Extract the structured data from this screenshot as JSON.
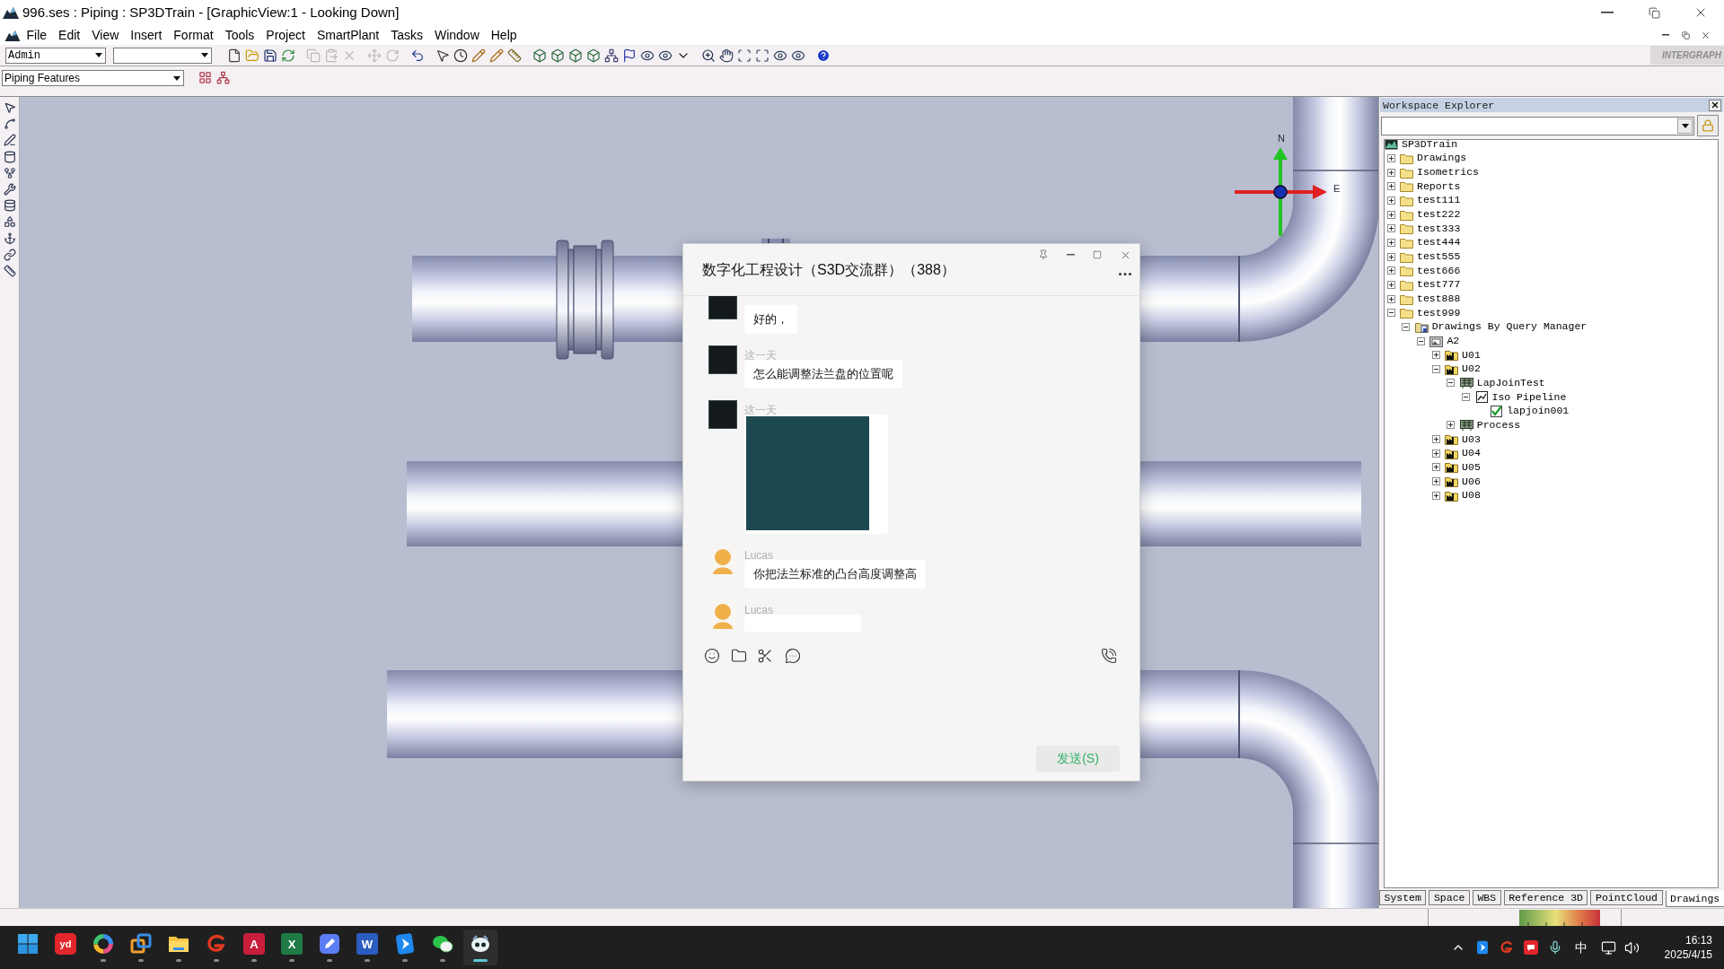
{
  "window": {
    "title": "996.ses : Piping : SP3DTrain - [GraphicView:1 - Looking Down]"
  },
  "menu": [
    "File",
    "Edit",
    "View",
    "Insert",
    "Format",
    "Tools",
    "Project",
    "SmartPlant",
    "Tasks",
    "Window",
    "Help"
  ],
  "toolbar": {
    "user_combo": "Admin",
    "groups": [
      [
        {
          "kind": "new",
          "disabled": false
        },
        {
          "kind": "open",
          "disabled": false
        },
        {
          "kind": "save",
          "disabled": false
        },
        {
          "kind": "refresh",
          "disabled": false
        }
      ],
      [
        {
          "kind": "copy",
          "disabled": true
        },
        {
          "kind": "paste",
          "disabled": true
        },
        {
          "kind": "delete",
          "disabled": true
        }
      ],
      [
        {
          "kind": "move",
          "disabled": true
        },
        {
          "kind": "rotate",
          "disabled": true
        }
      ],
      [
        {
          "kind": "undo",
          "disabled": false
        }
      ],
      [
        {
          "kind": "select",
          "disabled": false
        },
        {
          "kind": "clock",
          "disabled": false
        },
        {
          "kind": "pencil",
          "disabled": false
        },
        {
          "kind": "pencil",
          "disabled": false
        },
        {
          "kind": "ruler",
          "disabled": false
        }
      ],
      [
        {
          "kind": "cube",
          "disabled": false
        },
        {
          "kind": "cube",
          "disabled": false
        },
        {
          "kind": "cube",
          "disabled": false
        },
        {
          "kind": "cube",
          "disabled": false
        },
        {
          "kind": "network",
          "disabled": false
        },
        {
          "kind": "flag",
          "disabled": false
        },
        {
          "kind": "view",
          "disabled": false
        },
        {
          "kind": "view",
          "disabled": false
        },
        {
          "kind": "dropdown",
          "disabled": false
        }
      ],
      [
        {
          "kind": "zoom",
          "disabled": false
        },
        {
          "kind": "pan",
          "disabled": false
        },
        {
          "kind": "zoom_area",
          "disabled": false
        },
        {
          "kind": "fit",
          "disabled": false
        },
        {
          "kind": "view",
          "disabled": false
        },
        {
          "kind": "view",
          "disabled": false
        }
      ],
      [
        {
          "kind": "help",
          "disabled": false
        }
      ]
    ],
    "logo": "INTERGRAPH"
  },
  "task_bar": {
    "task_combo": "Piping Features"
  },
  "view": {
    "compass": {
      "north": "N",
      "east": "E"
    }
  },
  "workspace_explorer": {
    "title": "Workspace Explorer",
    "tree": [
      {
        "label": "SP3DTrain",
        "kind": "project",
        "children": [
          {
            "label": "Drawings",
            "kind": "folder",
            "expanded": false
          },
          {
            "label": "Isometrics",
            "kind": "folder",
            "expanded": false
          },
          {
            "label": "Reports",
            "kind": "folder",
            "expanded": false
          },
          {
            "label": "test111",
            "kind": "folder",
            "expanded": false
          },
          {
            "label": "test222",
            "kind": "folder",
            "expanded": false
          },
          {
            "label": "test333",
            "kind": "folder",
            "expanded": false
          },
          {
            "label": "test444",
            "kind": "folder",
            "expanded": false
          },
          {
            "label": "test555",
            "kind": "folder",
            "expanded": false
          },
          {
            "label": "test666",
            "kind": "folder",
            "expanded": false
          },
          {
            "label": "test777",
            "kind": "folder",
            "expanded": false
          },
          {
            "label": "test888",
            "kind": "folder",
            "expanded": false
          },
          {
            "label": "test999",
            "kind": "folder",
            "expanded": true,
            "children": [
              {
                "label": "Drawings By Query Manager",
                "kind": "query",
                "expanded": true,
                "children": [
                  {
                    "label": "A2",
                    "kind": "area",
                    "expanded": true,
                    "children": [
                      {
                        "label": "U01",
                        "kind": "unit",
                        "expanded": false
                      },
                      {
                        "label": "U02",
                        "kind": "unit",
                        "expanded": true,
                        "children": [
                          {
                            "label": "LapJoinTest",
                            "kind": "system",
                            "expanded": true,
                            "children": [
                              {
                                "label": "Iso Pipeline",
                                "kind": "iso",
                                "expanded": true,
                                "children": [
                                  {
                                    "label": "lapjoin001",
                                    "kind": "drawing"
                                  }
                                ]
                              }
                            ]
                          },
                          {
                            "label": "Process",
                            "kind": "system",
                            "expanded": false
                          }
                        ]
                      },
                      {
                        "label": "U03",
                        "kind": "unit",
                        "expanded": false
                      },
                      {
                        "label": "U04",
                        "kind": "unit",
                        "expanded": false
                      },
                      {
                        "label": "U05",
                        "kind": "unit",
                        "expanded": false
                      },
                      {
                        "label": "U06",
                        "kind": "unit",
                        "expanded": false
                      },
                      {
                        "label": "U08",
                        "kind": "unit",
                        "expanded": false
                      }
                    ]
                  }
                ]
              }
            ]
          }
        ]
      }
    ],
    "tabs": [
      {
        "label": "System",
        "selected": false
      },
      {
        "label": "Space",
        "selected": false
      },
      {
        "label": "WBS",
        "selected": false
      },
      {
        "label": "Reference 3D",
        "selected": false
      },
      {
        "label": "PointCloud",
        "selected": false
      },
      {
        "label": "Drawings",
        "selected": true
      }
    ]
  },
  "chat": {
    "title": "数字化工程设计（S3D交流群）（388）",
    "messages": [
      {
        "kind": "text",
        "avatar": {
          "kind": "photo"
        },
        "text": "好的，"
      },
      {
        "kind": "text",
        "avatar": {
          "kind": "photo"
        },
        "sender": "这一天",
        "text": "怎么能调整法兰盘的位置呢"
      },
      {
        "kind": "image",
        "avatar": {
          "kind": "photo"
        },
        "sender": "这一天"
      },
      {
        "kind": "text",
        "avatar": {
          "kind": "cartoon"
        },
        "sender": "Lucas",
        "text": "你把法兰标准的凸台高度调整高"
      },
      {
        "kind": "text",
        "avatar": {
          "kind": "cartoon"
        },
        "sender": "Lucas"
      }
    ],
    "send_button": "发送(S)"
  },
  "taskbar": {
    "apps": [
      {
        "kind": "start",
        "running": false,
        "selected": false
      },
      {
        "kind": "dictionary",
        "glyph": "yd",
        "running": false,
        "selected": false
      },
      {
        "kind": "browser",
        "running": true,
        "selected": false
      },
      {
        "kind": "windows",
        "running": true,
        "selected": false
      },
      {
        "kind": "files",
        "running": true,
        "selected": false
      },
      {
        "kind": "swirl",
        "running": true,
        "selected": false
      },
      {
        "kind": "cad",
        "glyph": "A",
        "running": true,
        "selected": false
      },
      {
        "kind": "sheet",
        "glyph": "X",
        "running": true,
        "selected": false
      },
      {
        "kind": "notes",
        "running": true,
        "selected": false
      },
      {
        "kind": "word",
        "glyph": "W",
        "running": true,
        "selected": false
      },
      {
        "kind": "arrow",
        "running": true,
        "selected": false
      },
      {
        "kind": "chat",
        "running": true,
        "selected": false
      },
      {
        "kind": "bot",
        "running": true,
        "selected": true
      }
    ],
    "tray": {
      "ime": "中",
      "time": "16:13",
      "date": "2025/4/15"
    }
  }
}
